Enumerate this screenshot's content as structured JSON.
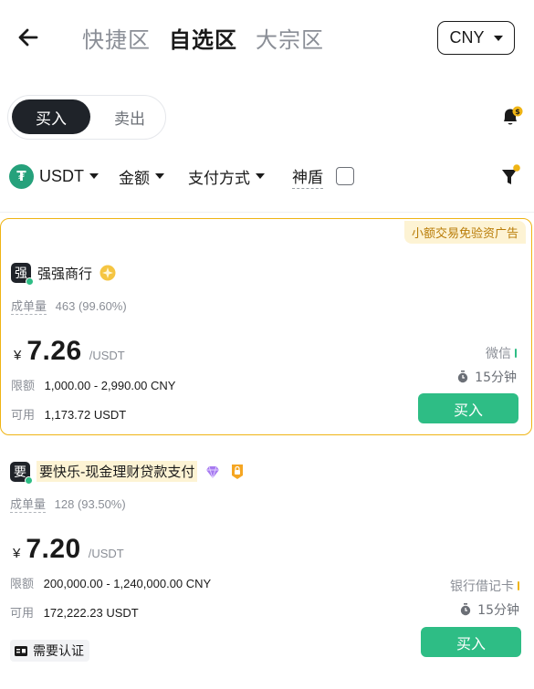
{
  "header": {
    "tabs": [
      {
        "label": "快捷区",
        "active": false
      },
      {
        "label": "自选区",
        "active": true
      },
      {
        "label": "大宗区",
        "active": false
      }
    ],
    "currency": "CNY"
  },
  "toggle": {
    "buy": "买入",
    "sell": "卖出",
    "active": "buy"
  },
  "filters": {
    "asset": "USDT",
    "amount": "金额",
    "payment": "支付方式",
    "shield": "神盾"
  },
  "ads": [
    {
      "promo": "小额交易免验资广告",
      "avatar": "强",
      "merchant": "强强商行",
      "stats_label": "成单量",
      "stats_value": "463 (99.60%)",
      "currency_symbol": "¥",
      "price": "7.26",
      "price_unit": "/USDT",
      "limit_label": "限额",
      "limit_value": "1,000.00 - 2,990.00 CNY",
      "available_label": "可用",
      "available_value": "1,173.72 USDT",
      "payment_method": "微信",
      "payment_color": "#2ebd85",
      "time": "15分钟",
      "button": "买入"
    },
    {
      "avatar": "要",
      "merchant": "要快乐-现金理财贷款支付",
      "stats_label": "成单量",
      "stats_value": "128 (93.50%)",
      "currency_symbol": "¥",
      "price": "7.20",
      "price_unit": "/USDT",
      "limit_label": "限额",
      "limit_value": "200,000.00 - 1,240,000.00 CNY",
      "available_label": "可用",
      "available_value": "172,222.23 USDT",
      "payment_method": "银行借记卡",
      "payment_color": "#efb414",
      "time": "15分钟",
      "verify": "需要认证",
      "button": "买入"
    }
  ],
  "colors": {
    "accent_green": "#2ebd85",
    "promo_gold": "#efb414",
    "dark": "#1f2329"
  }
}
